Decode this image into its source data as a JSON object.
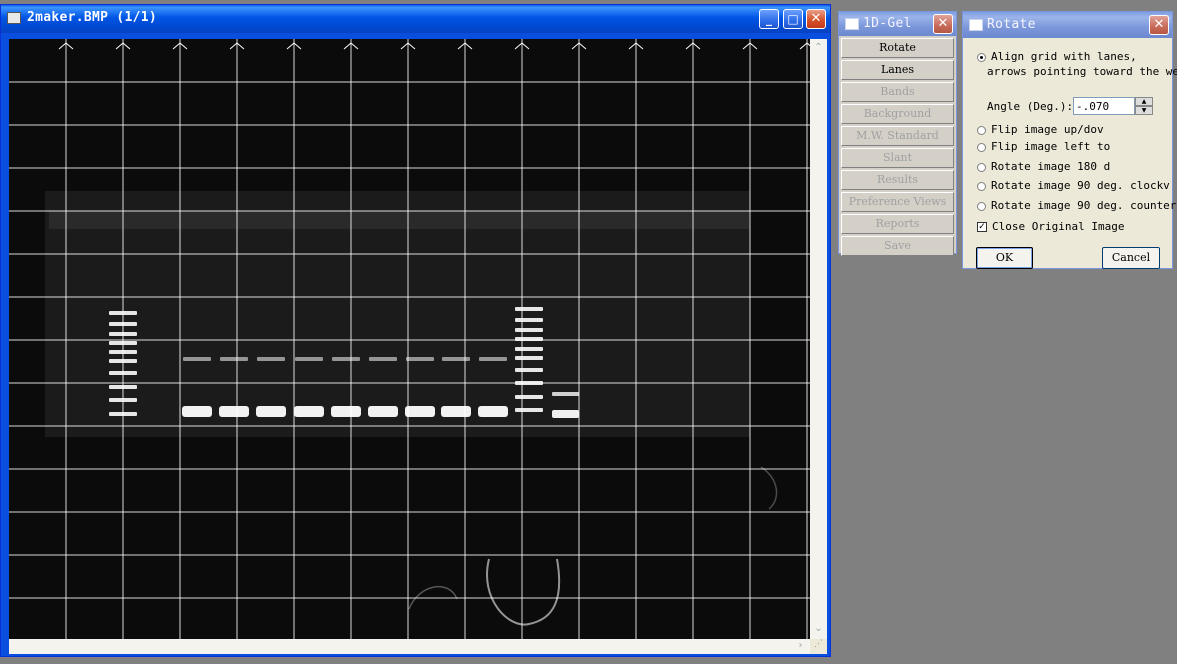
{
  "gel_window": {
    "title": "2maker.BMP  (1/1)",
    "minimize_glyph": "_",
    "maximize_glyph": "□",
    "close_glyph": "✕",
    "background": "#0B0B0B"
  },
  "toolbox": {
    "title": "1D-Gel",
    "close_glyph": "✕",
    "items": [
      {
        "label": "Rotate",
        "enabled": true
      },
      {
        "label": "Lanes",
        "enabled": true
      },
      {
        "label": "Bands",
        "enabled": false
      },
      {
        "label": "Background",
        "enabled": false
      },
      {
        "label": "M.W. Standard",
        "enabled": false
      },
      {
        "label": "Slant",
        "enabled": false
      },
      {
        "label": "Results",
        "enabled": false
      },
      {
        "label": "Preference Views",
        "enabled": false
      },
      {
        "label": "Reports",
        "enabled": false
      },
      {
        "label": "Save",
        "enabled": false
      }
    ]
  },
  "rotate_dialog": {
    "title": "Rotate",
    "close_glyph": "✕",
    "align_line1": "Align grid with lanes,",
    "align_line2": "arrows pointing toward the we",
    "angle_label": "Angle (Deg.):",
    "angle_value": "-.070",
    "options": [
      {
        "label": "Flip image up/dov",
        "selected": false
      },
      {
        "label": "Flip image left to",
        "selected": false
      },
      {
        "label": "Rotate image 180 d",
        "selected": false
      },
      {
        "label": "Rotate image 90 deg. clockv",
        "selected": false
      },
      {
        "label": "Rotate image 90 deg. counterc",
        "selected": false
      }
    ],
    "close_original_label": "Close Original Image",
    "close_original_checked": true,
    "ok_label": "OK",
    "cancel_label": "Cancel"
  }
}
